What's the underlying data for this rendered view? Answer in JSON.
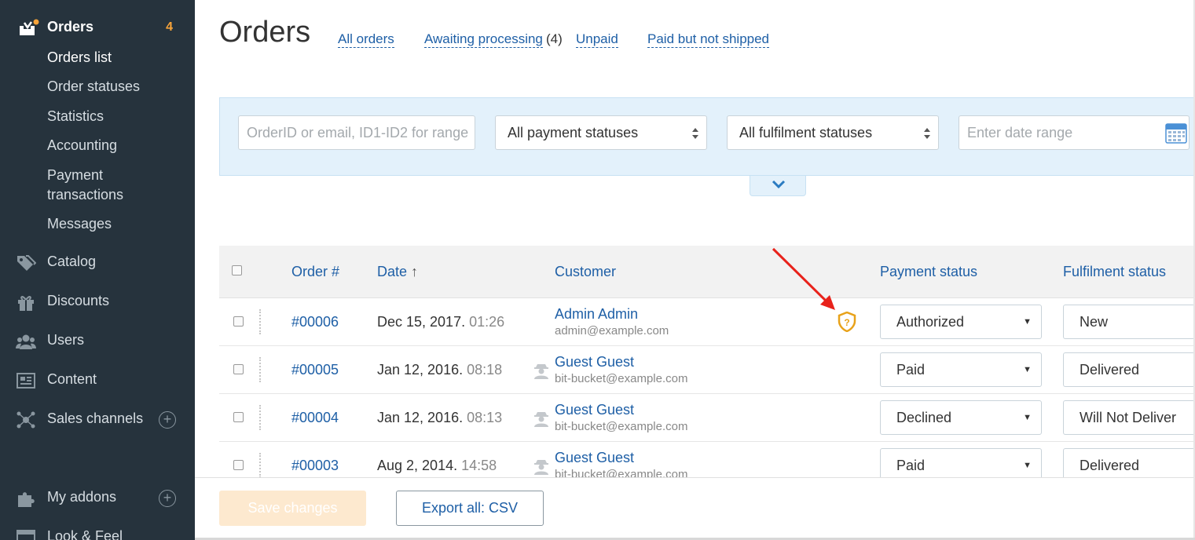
{
  "sidebar": {
    "header": {
      "title": "Orders",
      "badge": "4",
      "icon": "orders-inbox-icon"
    },
    "sub_items": [
      "Orders list",
      "Order statuses",
      "Statistics",
      "Accounting",
      "Payment transactions",
      "Messages"
    ],
    "nav": [
      {
        "label": "Catalog",
        "icon": "tags-icon"
      },
      {
        "label": "Discounts",
        "icon": "gift-icon"
      },
      {
        "label": "Users",
        "icon": "users-icon"
      },
      {
        "label": "Content",
        "icon": "content-icon"
      },
      {
        "label": "Sales channels",
        "icon": "network-icon"
      },
      {
        "label": "My addons",
        "icon": "puzzle-icon"
      },
      {
        "label": "Look & Feel",
        "icon": "layout-icon"
      }
    ]
  },
  "header": {
    "title": "Orders",
    "tabs": {
      "all": "All orders",
      "awaiting": "Awaiting processing",
      "awaiting_count": "(4)",
      "unpaid": "Unpaid",
      "paid_not_shipped": "Paid but not shipped"
    }
  },
  "filters": {
    "search_placeholder": "OrderID or email, ID1-ID2 for range",
    "payment_status": "All payment statuses",
    "fulfilment_status": "All fulfilment statuses",
    "date_placeholder": "Enter date range"
  },
  "table": {
    "headers": {
      "order": "Order #",
      "date": "Date",
      "date_sort": "↑",
      "customer": "Customer",
      "payment": "Payment status",
      "fulfilment": "Fulfilment status"
    },
    "rows": [
      {
        "order": "#00006",
        "date": "Dec 15, 2017.",
        "time": "01:26",
        "name": "Admin Admin",
        "email": "admin@example.com",
        "payment": "Authorized",
        "fulfilment": "New"
      },
      {
        "order": "#00005",
        "date": "Jan 12, 2016.",
        "time": "08:18",
        "name": "Guest Guest",
        "email": "bit-bucket@example.com",
        "payment": "Paid",
        "fulfilment": "Delivered"
      },
      {
        "order": "#00004",
        "date": "Jan 12, 2016.",
        "time": "08:13",
        "name": "Guest Guest",
        "email": "bit-bucket@example.com",
        "payment": "Declined",
        "fulfilment": "Will Not Deliver"
      },
      {
        "order": "#00003",
        "date": "Aug 2, 2014.",
        "time": "14:58",
        "name": "Guest Guest",
        "email": "bit-bucket@example.com",
        "payment": "Paid",
        "fulfilment": "Delivered"
      }
    ]
  },
  "footer": {
    "save": "Save changes",
    "export": "Export all: CSV"
  },
  "colors": {
    "sidebar_bg": "#26333d",
    "link": "#1e5fa6",
    "accent": "#f7a43a",
    "fraud_shield": "#e8a21a",
    "annotation_arrow": "#e8221b"
  }
}
